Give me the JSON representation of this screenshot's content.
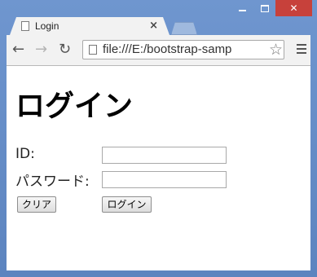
{
  "window": {
    "minimize_icon": "minimize-icon",
    "maximize_icon": "maximize-icon",
    "close_icon": "close-icon",
    "close_glyph": "✕"
  },
  "tab": {
    "title": "Login",
    "close_glyph": "×"
  },
  "toolbar": {
    "back_glyph": "←",
    "forward_glyph": "→",
    "reload_glyph": "↻",
    "url": "file:///E:/bootstrap-samp",
    "star_glyph": "☆"
  },
  "page": {
    "heading": "ログイン",
    "id_label": "ID:",
    "password_label": "パスワード:",
    "id_value": "",
    "password_value": "",
    "clear_button": "クリア",
    "login_button": "ログイン"
  },
  "colors": {
    "frame": "#6189c3",
    "close_button": "#c7413b",
    "toolbar": "#f2f2f2"
  }
}
